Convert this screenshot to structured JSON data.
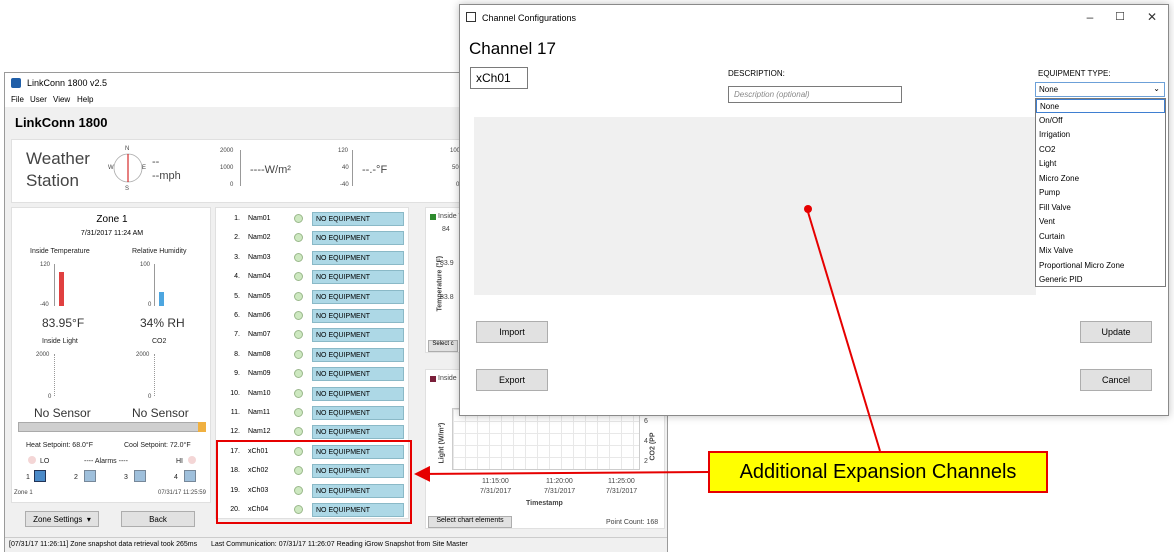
{
  "main_window": {
    "title": "LinkConn 1800 v2.5",
    "menu": [
      "File",
      "User",
      "View",
      "Help"
    ],
    "app_name": "LinkConn 1800",
    "weather_station": {
      "label_line1": "Weather",
      "label_line2": "Station",
      "compass": {
        "n": "N",
        "s": "S",
        "e": "E",
        "w": "W"
      },
      "wind_top": "--",
      "wind_unit": "--mph",
      "solar_ticks": [
        "2000",
        "1000",
        "0"
      ],
      "solar_value": "----W/m²",
      "temp_ticks": [
        "120",
        "40",
        "-40"
      ],
      "temp_value": "--.-°F",
      "right_ticks": [
        "100",
        "50",
        "0"
      ]
    },
    "zone": {
      "title": "Zone 1",
      "datetime": "7/31/2017 11:24 AM",
      "inside_temp_label": "Inside Temperature",
      "humidity_label": "Relative Humidity",
      "temp_ticks": [
        "120",
        "-40"
      ],
      "hum_ticks": [
        "100",
        "0"
      ],
      "temp_value": "83.95°F",
      "hum_value": "34% RH",
      "inside_light_label": "Inside Light",
      "co2_label": "CO2",
      "light_ticks": [
        "2000",
        "0"
      ],
      "co2_ticks": [
        "2000",
        "0"
      ],
      "light_value": "No Sensor",
      "co2_value": "No Sensor",
      "heat_setpoint": "Heat Setpoint: 68.0°F",
      "cool_setpoint": "Cool Setpoint: 72.0°F",
      "lo": "LO",
      "hi": "HI",
      "alarms": "---- Alarms ----",
      "alarm_nums": [
        "1",
        "2",
        "3",
        "4"
      ],
      "footer_zone": "Zone 1",
      "footer_time": "07/31/17 11:25:59"
    },
    "channels": [
      {
        "num": "1.",
        "name": "Nam01",
        "equipment": "NO EQUIPMENT"
      },
      {
        "num": "2.",
        "name": "Nam02",
        "equipment": "NO EQUIPMENT"
      },
      {
        "num": "3.",
        "name": "Nam03",
        "equipment": "NO EQUIPMENT"
      },
      {
        "num": "4.",
        "name": "Nam04",
        "equipment": "NO EQUIPMENT"
      },
      {
        "num": "5.",
        "name": "Nam05",
        "equipment": "NO EQUIPMENT"
      },
      {
        "num": "6.",
        "name": "Nam06",
        "equipment": "NO EQUIPMENT"
      },
      {
        "num": "7.",
        "name": "Nam07",
        "equipment": "NO EQUIPMENT"
      },
      {
        "num": "8.",
        "name": "Nam08",
        "equipment": "NO EQUIPMENT"
      },
      {
        "num": "9.",
        "name": "Nam09",
        "equipment": "NO EQUIPMENT"
      },
      {
        "num": "10.",
        "name": "Nam10",
        "equipment": "NO EQUIPMENT"
      },
      {
        "num": "11.",
        "name": "Nam11",
        "equipment": "NO EQUIPMENT"
      },
      {
        "num": "12.",
        "name": "Nam12",
        "equipment": "NO EQUIPMENT"
      },
      {
        "num": "17.",
        "name": "xCh01",
        "equipment": "NO EQUIPMENT"
      },
      {
        "num": "18.",
        "name": "xCh02",
        "equipment": "NO EQUIPMENT"
      },
      {
        "num": "19.",
        "name": "xCh03",
        "equipment": "NO EQUIPMENT"
      },
      {
        "num": "20.",
        "name": "xCh04",
        "equipment": "NO EQUIPMENT"
      }
    ],
    "chart1": {
      "legend": "Inside T",
      "ylabel": "Temperature (°F)",
      "yticks": [
        "84",
        "83.9",
        "83.8"
      ],
      "select_btn": "Select c"
    },
    "chart2": {
      "legend": "Inside",
      "ylabel": "Light (W/m²)",
      "y2label": "CO2 (PP",
      "y2ticks": [
        "6",
        "4",
        "2"
      ],
      "xticks": [
        {
          "time": "11:15:00",
          "date": "7/31/2017"
        },
        {
          "time": "11:20:00",
          "date": "7/31/2017"
        },
        {
          "time": "11:25:00",
          "date": "7/31/2017"
        }
      ],
      "xlabel": "Timestamp",
      "select_btn": "Select chart elements",
      "point_count": "Point Count: 168"
    },
    "zone_settings_btn": "Zone Settings",
    "back_btn": "Back",
    "status_left": "[07/31/17 11:26:11] Zone snapshot data retrieval took 265ms",
    "status_right": "Last Communication: 07/31/17 11:26:07 Reading iGrow Snapshot from Site Master"
  },
  "dialog": {
    "title": "Channel Configurations",
    "channel_title": "Channel 17",
    "name_value": "xCh01",
    "description_label": "DESCRIPTION:",
    "description_placeholder": "Description (optional)",
    "equipment_label": "EQUIPMENT TYPE:",
    "equipment_selected": "None",
    "equipment_options": [
      "None",
      "On/Off",
      "Irrigation",
      "CO2",
      "Light",
      "Micro Zone",
      "Pump",
      "Fill Valve",
      "Vent",
      "Curtain",
      "Mix Valve",
      "Proportional Micro Zone",
      "Generic PID"
    ],
    "import_btn": "Import",
    "export_btn": "Export",
    "update_btn": "Update",
    "cancel_btn": "Cancel"
  },
  "annotation": {
    "callout_text": "Additional Expansion Channels",
    "color": "#e60000",
    "fill": "#ffff00"
  }
}
